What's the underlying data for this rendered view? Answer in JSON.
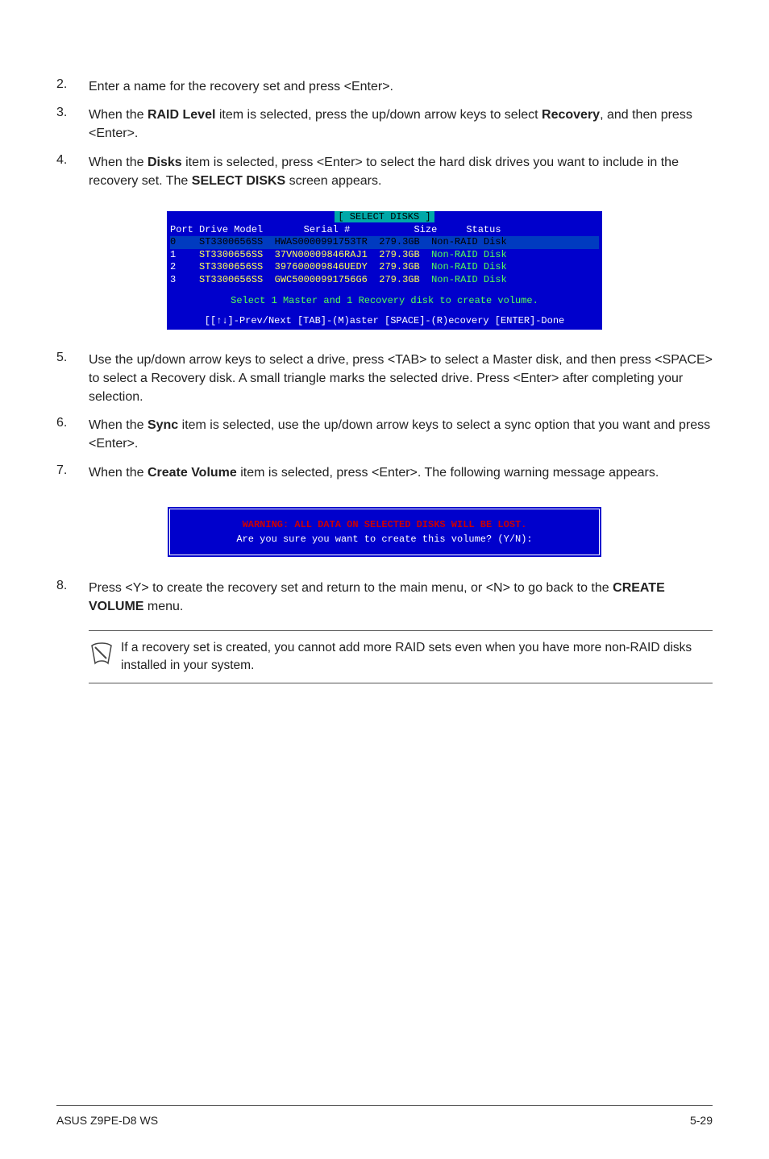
{
  "steps_top": [
    {
      "num": "2.",
      "body": "Enter a name for the recovery set and press <Enter>."
    },
    {
      "num": "3.",
      "body": "When the <b>RAID Level</b> item is selected, press the up/down arrow keys to select <b>Recovery</b>, and then press <Enter>."
    },
    {
      "num": "4.",
      "body": "When the <b>Disks</b> item is selected, press <Enter> to select the hard disk drives you want to include in the recovery set. The <b>SELECT DISKS</b> screen appears."
    }
  ],
  "terminal": {
    "title": "[ SELECT DISKS ]",
    "header": {
      "c0": "Port",
      "c1": "Drive Model",
      "c2": "Serial #",
      "c3": "Size",
      "c4": "Status"
    },
    "rows": [
      {
        "hi": true,
        "c0": "0",
        "c1": "ST3300656SS",
        "c2": "HWAS0000991753TR",
        "c3": "279.3GB",
        "c4": "Non-RAID Disk"
      },
      {
        "hi": false,
        "c0": "1",
        "c1": "ST3300656SS",
        "c2": "37VN00009846RAJ1",
        "c3": "279.3GB",
        "c4": "Non-RAID Disk"
      },
      {
        "hi": false,
        "c0": "2",
        "c1": "ST3300656SS",
        "c2": "397600009846UEDY",
        "c3": "279.3GB",
        "c4": "Non-RAID Disk"
      },
      {
        "hi": false,
        "c0": "3",
        "c1": "ST3300656SS",
        "c2": "GWC50000991756G6",
        "c3": "279.3GB",
        "c4": "Non-RAID Disk"
      }
    ],
    "msg": "Select 1 Master and 1 Recovery disk to create volume.",
    "footer": "[[↑↓]-Prev/Next [TAB]-(M)aster [SPACE]-(R)ecovery [ENTER]-Done"
  },
  "steps_bottom": [
    {
      "num": "5.",
      "body": "Use the up/down arrow keys to select a drive, press <TAB> to select a Master disk, and then press <SPACE> to select a Recovery disk. A small triangle marks the selected drive. Press <Enter> after completing your selection."
    },
    {
      "num": "6.",
      "body": "When the <b>Sync</b> item is selected, use the up/down arrow keys to select a sync option that you want and press <Enter>."
    },
    {
      "num": "7.",
      "body": "When the <b>Create Volume</b> item is selected, press <Enter>. The following warning message appears."
    }
  ],
  "warning": {
    "line1": "WARNING: ALL DATA ON SELECTED DISKS WILL BE LOST.",
    "line2": "Are you sure you want to create this volume? (Y/N):"
  },
  "step8": {
    "num": "8.",
    "body": "Press <Y> to create the recovery set and return to the main menu, or <N> to go back to the <b>CREATE VOLUME</b> menu."
  },
  "note": "If a recovery set is created, you cannot add more RAID sets even when you have more non-RAID disks installed in your system.",
  "footer_left": "ASUS Z9PE-D8 WS",
  "footer_right": "5-29"
}
